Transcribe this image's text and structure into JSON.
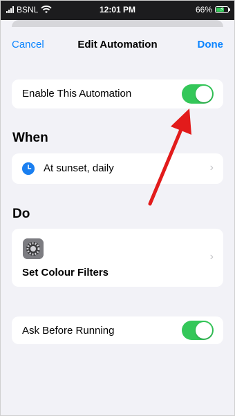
{
  "status_bar": {
    "carrier": "BSNL",
    "time": "12:01 PM",
    "battery": "66%"
  },
  "nav": {
    "cancel": "Cancel",
    "title": "Edit Automation",
    "done": "Done"
  },
  "enable_row": {
    "label": "Enable This Automation",
    "on": true
  },
  "when": {
    "title": "When",
    "trigger": "At sunset, daily"
  },
  "do": {
    "title": "Do",
    "action": "Set Colour Filters"
  },
  "ask_row": {
    "label": "Ask Before Running",
    "on": true
  },
  "colors": {
    "accent": "#0a84ff",
    "toggle_on": "#34c759",
    "annotation_arrow": "#e21b1b"
  },
  "icons": [
    "wifi-icon",
    "battery-icon",
    "clock-icon",
    "settings-gear-icon",
    "chevron-right-icon"
  ]
}
